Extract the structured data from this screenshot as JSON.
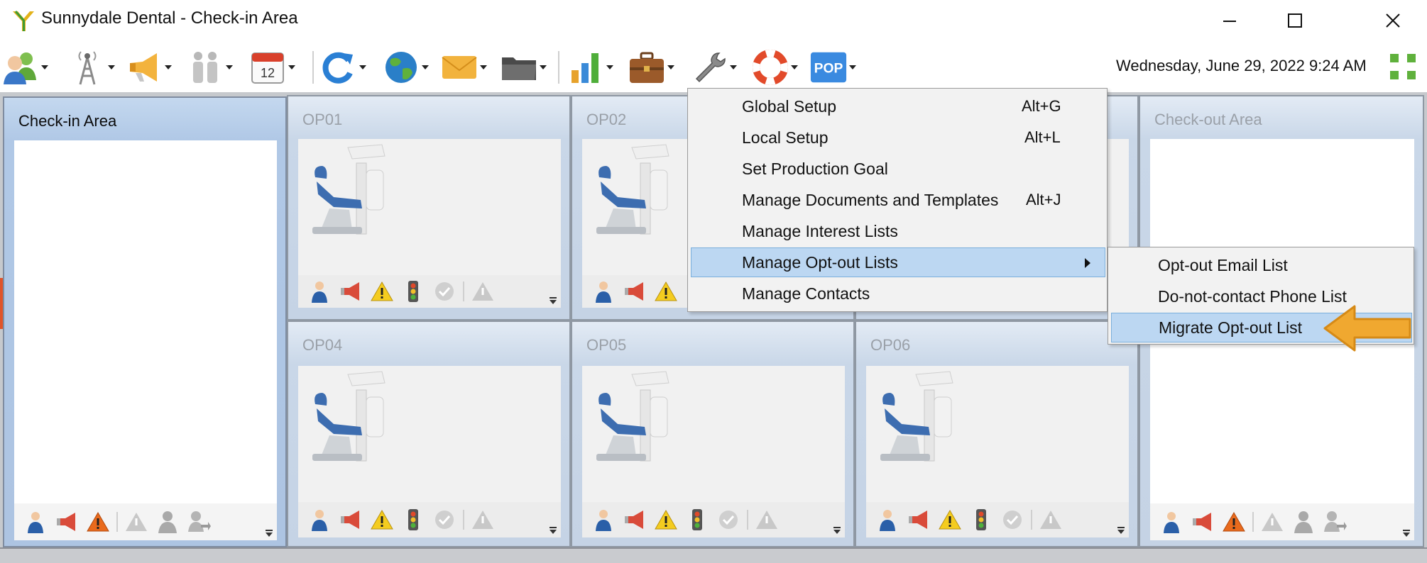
{
  "window": {
    "title": "Sunnydale Dental - Check-in Area",
    "controls": [
      "minimize",
      "maximize",
      "close"
    ]
  },
  "toolbar": {
    "buttons": [
      {
        "icon": "patients-icon",
        "has_dropdown": true
      },
      {
        "icon": "radio-tower-icon",
        "has_dropdown": true
      },
      {
        "icon": "megaphone-icon",
        "has_dropdown": true
      },
      {
        "icon": "family-icon",
        "has_dropdown": true
      },
      {
        "icon": "calendar-icon",
        "label": "12",
        "has_dropdown": true
      },
      {
        "icon": "refresh-icon",
        "has_dropdown": true
      },
      {
        "icon": "globe-icon",
        "has_dropdown": true
      },
      {
        "icon": "email-icon",
        "has_dropdown": true
      },
      {
        "icon": "folder-icon",
        "has_dropdown": true
      },
      {
        "icon": "bar-chart-icon",
        "has_dropdown": true
      },
      {
        "icon": "briefcase-icon",
        "has_dropdown": true
      },
      {
        "icon": "wrench-icon",
        "has_dropdown": true,
        "active": true
      },
      {
        "icon": "lifebuoy-icon",
        "has_dropdown": true
      },
      {
        "icon": "pop-icon",
        "label": "POP",
        "has_dropdown": true
      }
    ],
    "datetime": "Wednesday, June 29, 2022 9:24 AM"
  },
  "panels": {
    "checkin": {
      "title": "Check-in Area"
    },
    "op01": {
      "title": "OP01"
    },
    "op02": {
      "title": "OP02"
    },
    "op04": {
      "title": "OP04"
    },
    "op05": {
      "title": "OP05"
    },
    "op06": {
      "title": "OP06"
    },
    "checkout": {
      "title": "Check-out Area"
    }
  },
  "menu": {
    "items": [
      {
        "label": "Global Setup",
        "shortcut": "Alt+G"
      },
      {
        "label": "Local Setup",
        "shortcut": "Alt+L"
      },
      {
        "label": "Set Production Goal",
        "shortcut": ""
      },
      {
        "label": "Manage Documents and Templates",
        "shortcut": "Alt+J"
      },
      {
        "label": "Manage Interest Lists",
        "shortcut": ""
      },
      {
        "label": "Manage Opt-out Lists",
        "shortcut": "",
        "has_submenu": true,
        "highlighted": true
      },
      {
        "label": "Manage Contacts",
        "shortcut": ""
      }
    ]
  },
  "submenu": {
    "items": [
      {
        "label": "Opt-out Email List"
      },
      {
        "label": "Do-not-contact Phone List"
      },
      {
        "label": "Migrate Opt-out List",
        "highlighted": true
      }
    ]
  },
  "colors": {
    "menu_highlight": "#bcd7f2",
    "annotation_arrow": "#f0a830",
    "checkin_header": "#b0c8e6",
    "alert_orange": "#e0542a"
  }
}
